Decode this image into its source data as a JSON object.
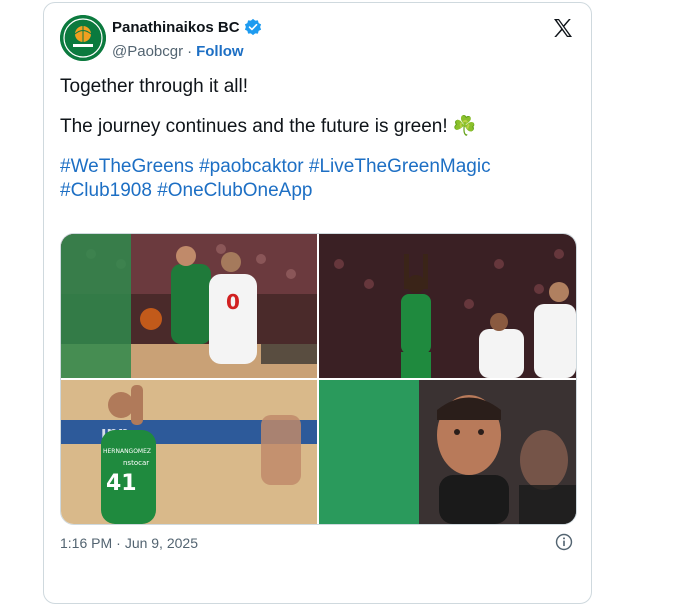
{
  "author": {
    "display_name": "Panathinaikos BC",
    "handle": "@Paobcgr",
    "separator": "·",
    "follow_label": "Follow",
    "verified": true
  },
  "tweet": {
    "line1": "Together through it all!",
    "line2": "The journey continues and the future is green! ☘️",
    "hashtags": [
      "#WeTheGreens",
      "#paobcaktor",
      "#LiveTheGreenMagic",
      "#Club1908",
      "#OneClubOneApp"
    ]
  },
  "photos": [
    {
      "jersey": "0"
    },
    {
      "jersey": ""
    },
    {
      "jersey": "41",
      "name": "HERNANGOMEZ",
      "sponsor": "nstocar"
    },
    {
      "jersey": ""
    }
  ],
  "meta": {
    "time": "1:16 PM",
    "separator": "·",
    "date": "Jun 9, 2025"
  },
  "icons": {
    "avatar": "club-logo",
    "x": "x-logo-icon",
    "info": "info-icon",
    "verified": "verified-badge-icon"
  },
  "colors": {
    "link": "#1d6fc4",
    "text": "#0f1419",
    "secondary": "#536471",
    "club_green": "#0b7a3e",
    "verified": "#1d9bf0"
  }
}
